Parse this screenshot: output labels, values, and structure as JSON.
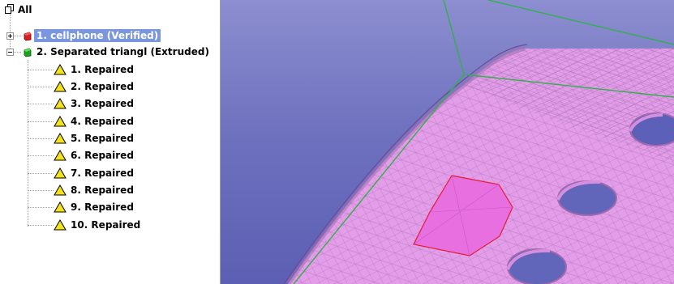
{
  "tree": {
    "root_label": "All",
    "items": [
      {
        "label": "1. cellphone (Verified)",
        "icon": "red-part-icon",
        "selected": true,
        "expander": "plus"
      },
      {
        "label": "2. Separated triangl (Extruded)",
        "icon": "green-part-icon",
        "selected": false,
        "expander": "minus",
        "children": [
          {
            "label": "1. Repaired"
          },
          {
            "label": "2. Repaired"
          },
          {
            "label": "3. Repaired"
          },
          {
            "label": "4. Repaired"
          },
          {
            "label": "5. Repaired"
          },
          {
            "label": "6. Repaired"
          },
          {
            "label": "7. Repaired"
          },
          {
            "label": "8. Repaired"
          },
          {
            "label": "9. Repaired"
          },
          {
            "label": "10. Repaired"
          }
        ]
      }
    ]
  },
  "colors": {
    "selection": "#7a96df",
    "mesh": "#e49de8",
    "mesh_highlight": "#e86fe0",
    "bounding_box": "#2fb04a",
    "warning_icon": "#f3e21a",
    "part_red": "#d42020",
    "part_green": "#19a319"
  }
}
